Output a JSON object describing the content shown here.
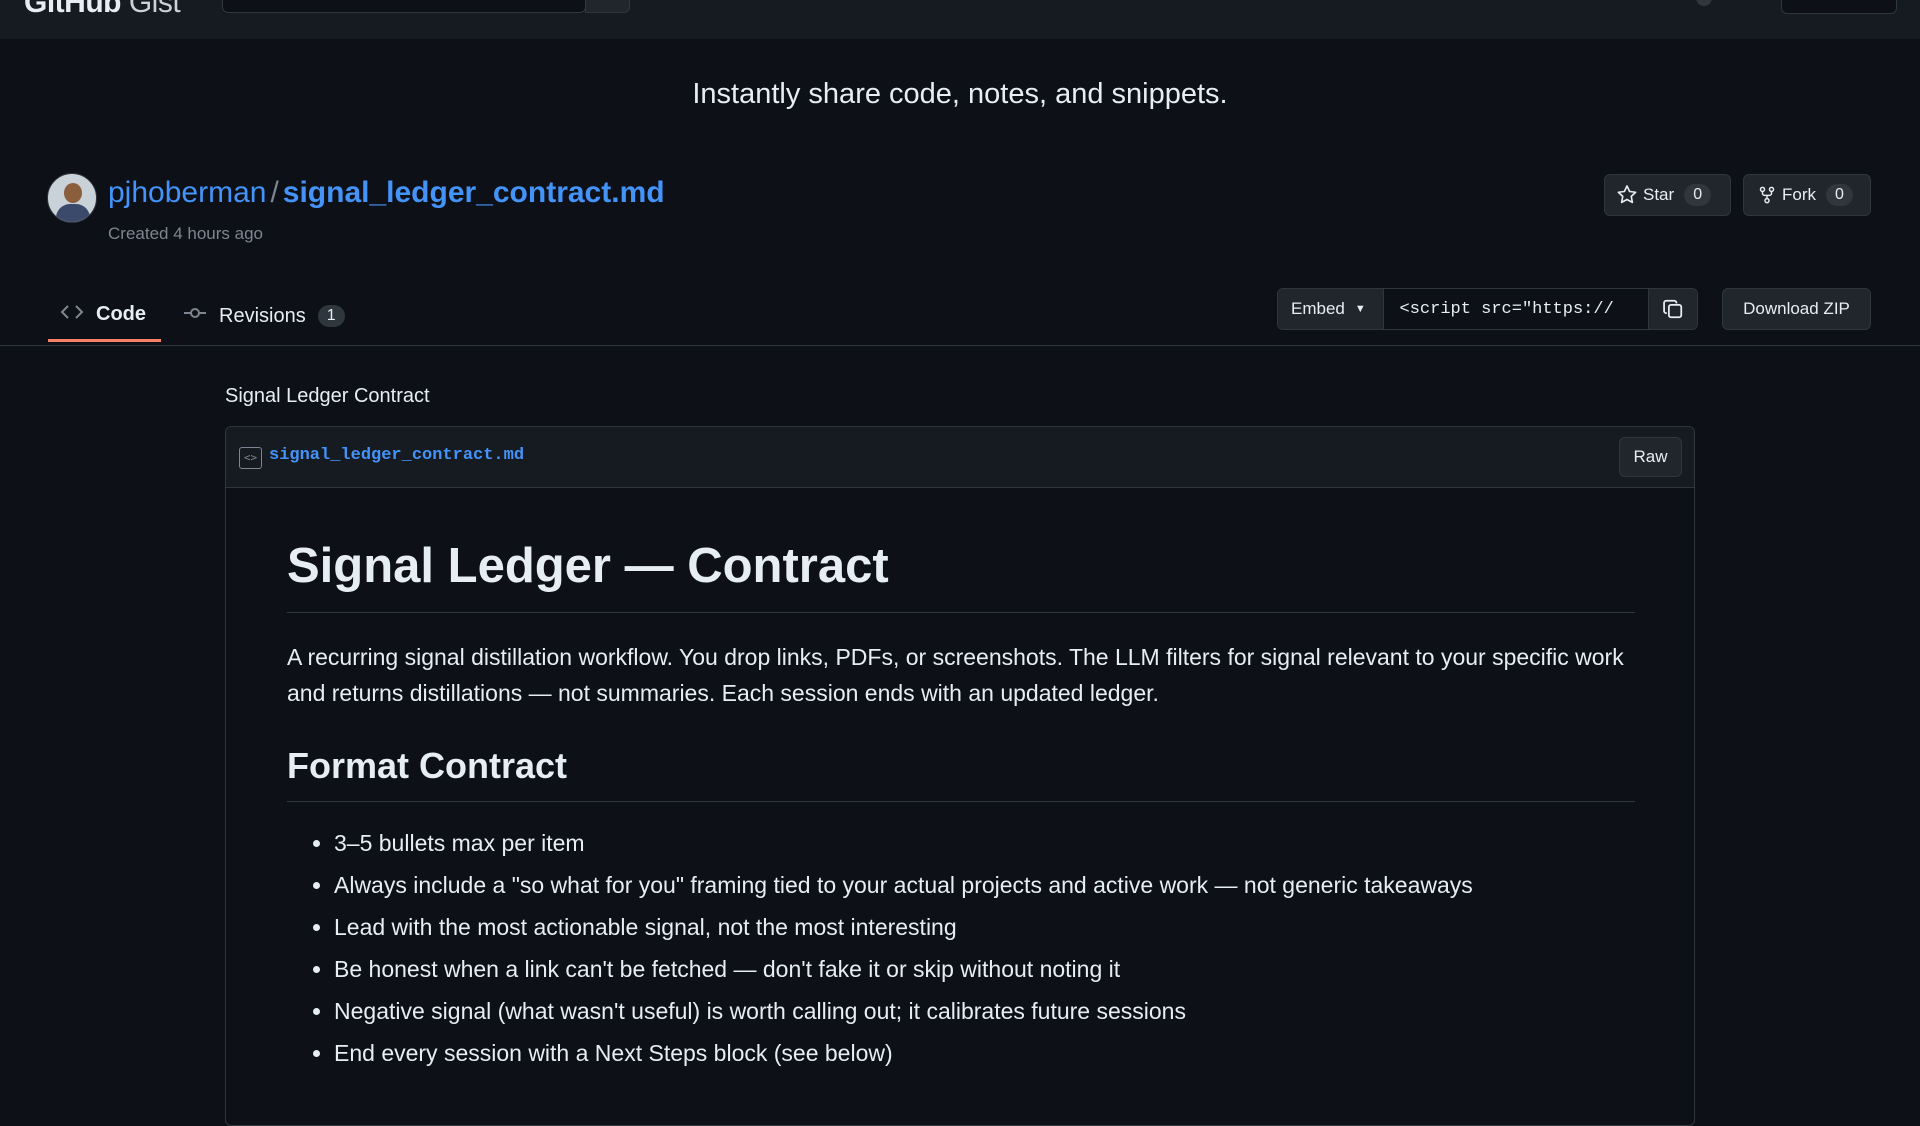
{
  "header": {
    "logo_bold": "GitHub",
    "logo_thin": "Gist"
  },
  "tagline": "Instantly share code, notes, and snippets.",
  "gist": {
    "owner": "pjhoberman",
    "separator": "/",
    "filename": "signal_ledger_contract.md",
    "created": "Created 4 hours ago",
    "star_label": "Star",
    "star_count": "0",
    "fork_label": "Fork",
    "fork_count": "0"
  },
  "tabs": {
    "code_label": "Code",
    "revisions_label": "Revisions",
    "revisions_count": "1"
  },
  "embed": {
    "select_label": "Embed",
    "url_value": "<script src=\"https://"
  },
  "download_label": "Download ZIP",
  "description": "Signal Ledger Contract",
  "file": {
    "name": "signal_ledger_contract.md",
    "raw_label": "Raw"
  },
  "markdown": {
    "h1": "Signal Ledger — Contract",
    "intro": "A recurring signal distillation workflow. You drop links, PDFs, or screenshots. The LLM filters for signal relevant to your specific work and returns distillations — not summaries. Each session ends with an updated ledger.",
    "h2": "Format Contract",
    "bullets": [
      "3–5 bullets max per item",
      "Always include a \"so what for you\" framing tied to your actual projects and active work — not generic takeaways",
      "Lead with the most actionable signal, not the most interesting",
      "Be honest when a link can't be fetched — don't fake it or skip without noting it",
      "Negative signal (what wasn't useful) is worth calling out; it calibrates future sessions",
      "End every session with a Next Steps block (see below)"
    ]
  },
  "colors": {
    "background": "#0d1117",
    "header": "#161b22",
    "link": "#4493f8",
    "tab_underline": "#f78166",
    "border": "#30363d"
  }
}
